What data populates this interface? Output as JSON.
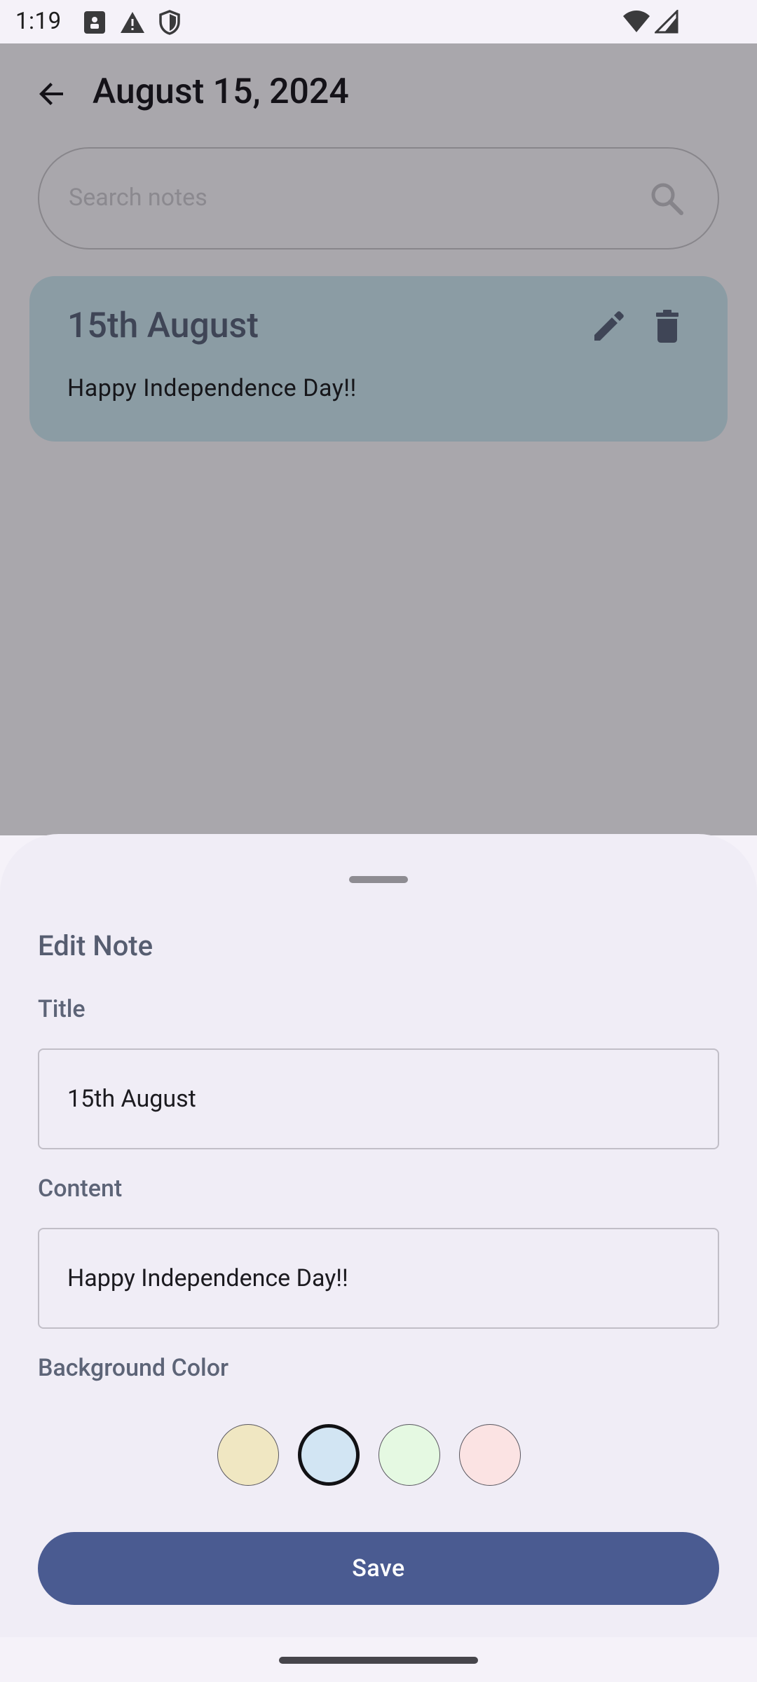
{
  "status_bar": {
    "time": "1:19"
  },
  "header": {
    "title": "August 15, 2024"
  },
  "search": {
    "placeholder": "Search notes"
  },
  "notes": [
    {
      "title": "15th August",
      "content": "Happy Independence Day!!",
      "color": "#8b9ca4"
    }
  ],
  "sheet": {
    "title": "Edit Note",
    "title_label": "Title",
    "title_value": "15th August",
    "content_label": "Content",
    "content_value": "Happy Independence Day!!",
    "color_label": "Background Color",
    "colors": [
      {
        "name": "yellow",
        "hex": "#f0e7c2",
        "selected": false
      },
      {
        "name": "blue",
        "hex": "#d2e5f3",
        "selected": true
      },
      {
        "name": "green",
        "hex": "#e5f9e2",
        "selected": false
      },
      {
        "name": "pink",
        "hex": "#fbe3e3",
        "selected": false
      }
    ],
    "save_label": "Save"
  },
  "colors": {
    "accent": "#4a5b91",
    "scrim_background": "#a9a7ac",
    "sheet_background": "#f0edf6"
  }
}
